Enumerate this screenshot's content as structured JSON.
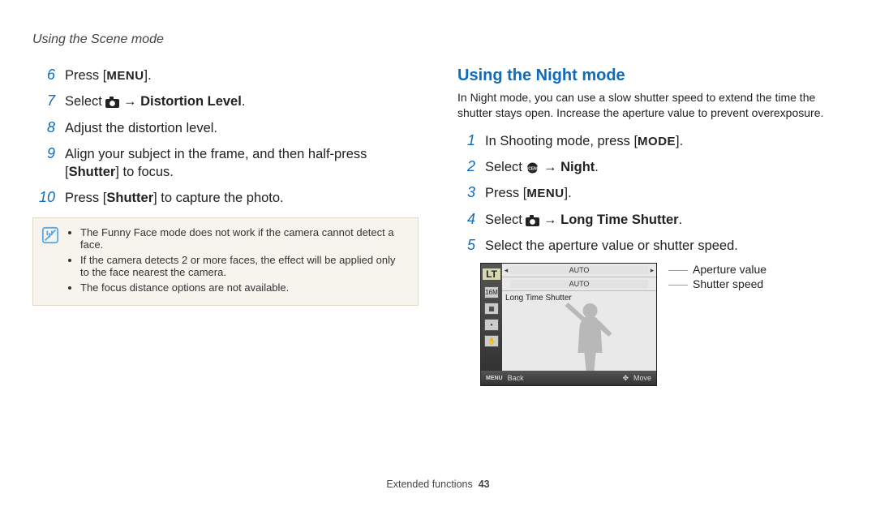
{
  "header": "Using the Scene mode",
  "left": {
    "steps": [
      {
        "n": "6",
        "parts": [
          "Press [",
          {
            "menu": true
          },
          "]."
        ]
      },
      {
        "n": "7",
        "parts": [
          "Select ",
          {
            "icon": "camera"
          },
          " → ",
          {
            "b": "Distortion Level"
          },
          "."
        ]
      },
      {
        "n": "8",
        "parts": [
          "Adjust the distortion level."
        ]
      },
      {
        "n": "9",
        "parts": [
          "Align your subject in the frame, and then half-press [",
          {
            "b": "Shutter"
          },
          "] to focus."
        ]
      },
      {
        "n": "10",
        "parts": [
          "Press [",
          {
            "b": "Shutter"
          },
          "] to capture the photo."
        ]
      }
    ],
    "notes": [
      "The Funny Face mode does not work if the camera cannot detect a face.",
      "If the camera detects 2 or more faces, the effect will be applied only to the face nearest the camera.",
      "The focus distance options are not available."
    ]
  },
  "right": {
    "title": "Using the Night mode",
    "intro": "In Night mode, you can use a slow shutter speed to extend the time the shutter stays open. Increase the aperture value to prevent overexposure.",
    "steps": [
      {
        "n": "1",
        "parts": [
          "In Shooting mode, press [",
          {
            "mode": true
          },
          "]."
        ]
      },
      {
        "n": "2",
        "parts": [
          "Select ",
          {
            "icon": "scene"
          },
          " → ",
          {
            "b": "Night"
          },
          "."
        ]
      },
      {
        "n": "3",
        "parts": [
          "Press [",
          {
            "menu": true
          },
          "]."
        ]
      },
      {
        "n": "4",
        "parts": [
          "Select ",
          {
            "icon": "camera"
          },
          " → ",
          {
            "b": "Long Time Shutter"
          },
          "."
        ]
      },
      {
        "n": "5",
        "parts": [
          "Select the aperture value or shutter speed."
        ]
      }
    ],
    "screen": {
      "lt": "LT",
      "auto1": "AUTO",
      "auto2": "AUTO",
      "lts": "Long Time Shutter",
      "menu_back_label": "Back",
      "menu_back_key": "MENU",
      "move": "Move"
    },
    "callouts": {
      "aperture": "Aperture value",
      "shutter": "Shutter speed"
    }
  },
  "footer": {
    "section": "Extended functions",
    "page": "43"
  }
}
